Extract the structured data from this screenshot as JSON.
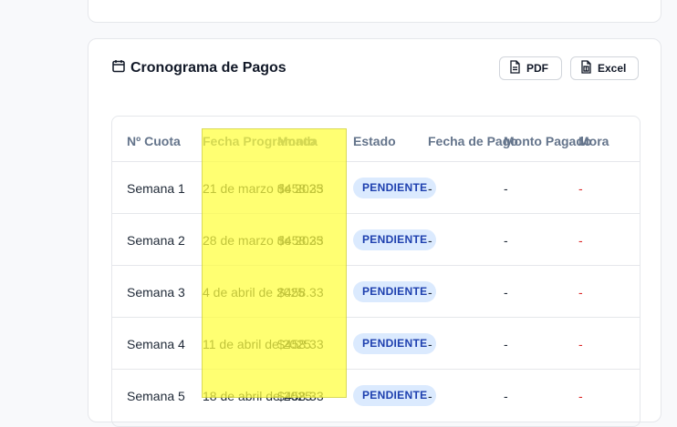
{
  "schedule": {
    "title": "Cronograma de Pagos",
    "pdf_label": "PDF",
    "excel_label": "Excel",
    "columns": [
      "Nº Cuota",
      "Fecha Programada",
      "Monto",
      "Estado",
      "Fecha de Pago",
      "Monto Pagado",
      "Mora"
    ],
    "rows": [
      {
        "cuota": "Semana 1",
        "fecha": "21 de marzo de 2025",
        "monto": "$458.33",
        "estado": "PENDIENTE",
        "fecha_pago": "-",
        "monto_pagado": "-",
        "mora": "-"
      },
      {
        "cuota": "Semana 2",
        "fecha": "28 de marzo de 2025",
        "monto": "$458.33",
        "estado": "PENDIENTE",
        "fecha_pago": "-",
        "monto_pagado": "-",
        "mora": "-"
      },
      {
        "cuota": "Semana 3",
        "fecha": "4 de abril de 2025",
        "monto": "$458.33",
        "estado": "PENDIENTE",
        "fecha_pago": "-",
        "monto_pagado": "-",
        "mora": "-"
      },
      {
        "cuota": "Semana 4",
        "fecha": "11 de abril de 2025",
        "monto": "$458.33",
        "estado": "PENDIENTE",
        "fecha_pago": "-",
        "monto_pagado": "-",
        "mora": "-"
      },
      {
        "cuota": "Semana 5",
        "fecha": "18 de abril de 2025",
        "monto": "$458.33",
        "estado": "PENDIENTE",
        "fecha_pago": "-",
        "monto_pagado": "-",
        "mora": "-"
      }
    ]
  },
  "colors": {
    "badge_bg": "#dbeafe",
    "badge_text": "#1e40af",
    "mora": "#dc2626",
    "highlight": "#ffff3c"
  }
}
